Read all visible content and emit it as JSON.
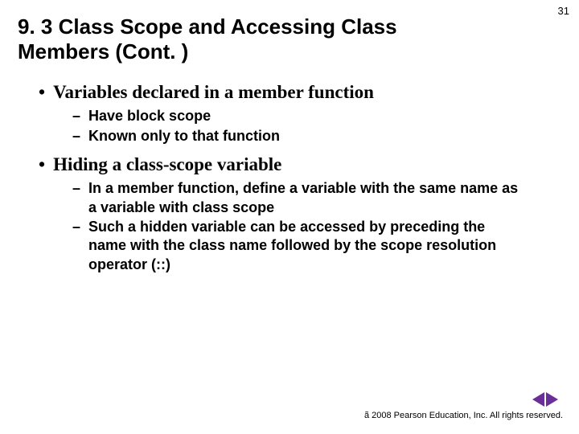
{
  "page_number": "31",
  "title": "9. 3 Class Scope and Accessing Class Members (Cont. )",
  "bullets": [
    {
      "text": "Variables declared in a member function",
      "subs": [
        "Have block scope",
        "Known only to that function"
      ]
    },
    {
      "text": "Hiding a class-scope variable",
      "subs": [
        "In a member function, define a variable with the same name as a variable with class scope",
        "Such a hidden variable can be accessed by preceding the name with the class name followed by the scope resolution operator (::)"
      ]
    }
  ],
  "footer": {
    "copyright_symbol": "ã",
    "text": "2008 Pearson Education, Inc.  All rights reserved."
  },
  "nav": {
    "prev": "previous-slide",
    "next": "next-slide"
  }
}
